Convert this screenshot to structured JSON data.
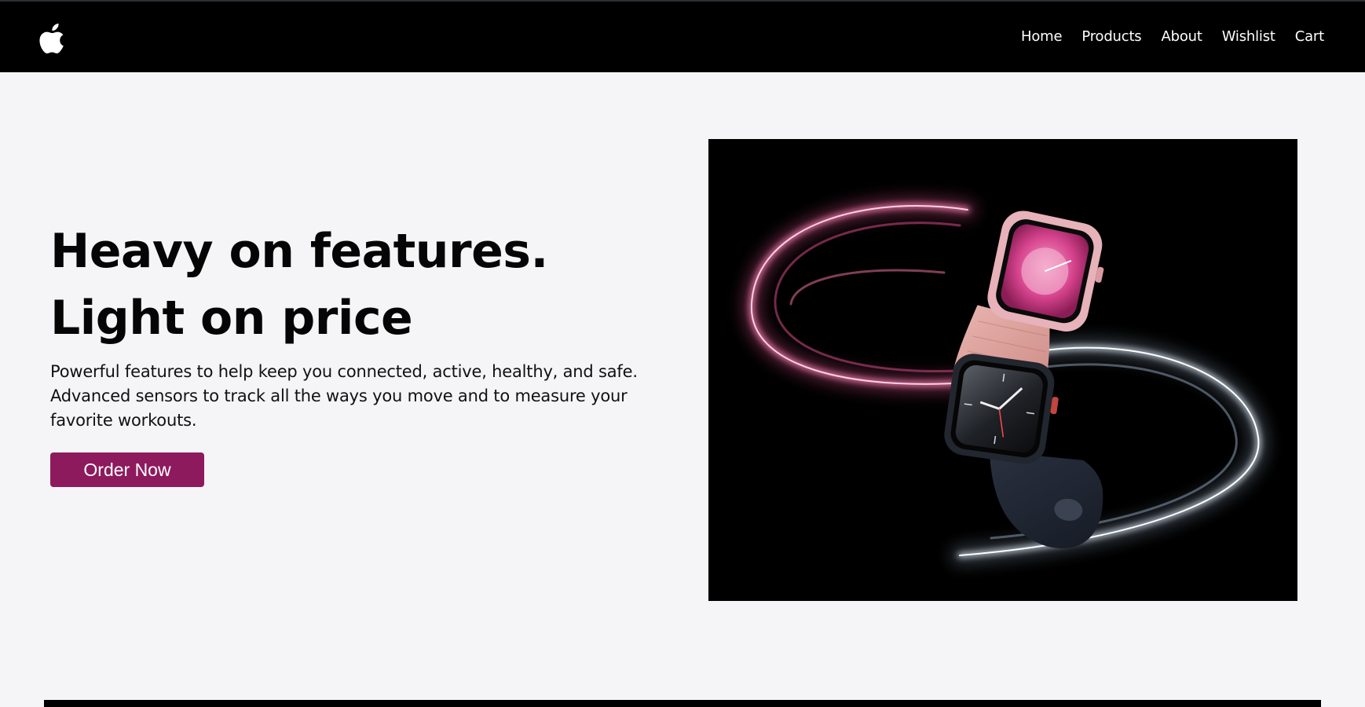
{
  "header": {
    "logo_icon": "apple-logo-icon",
    "nav": [
      {
        "label": "Home"
      },
      {
        "label": "Products"
      },
      {
        "label": "About"
      },
      {
        "label": "Wishlist"
      },
      {
        "label": "Cart"
      }
    ]
  },
  "hero": {
    "title": "Heavy on features. Light on price",
    "description": "Powerful features to help keep you connected, active, healthy, and safe. Advanced sensors to track all the ways you move and to measure your favorite workouts.",
    "button_label": "Order Now",
    "image_alt": "Two Apple Watches, one pink and one midnight, with glowing light trails",
    "button_color": "#8e1a5e"
  }
}
